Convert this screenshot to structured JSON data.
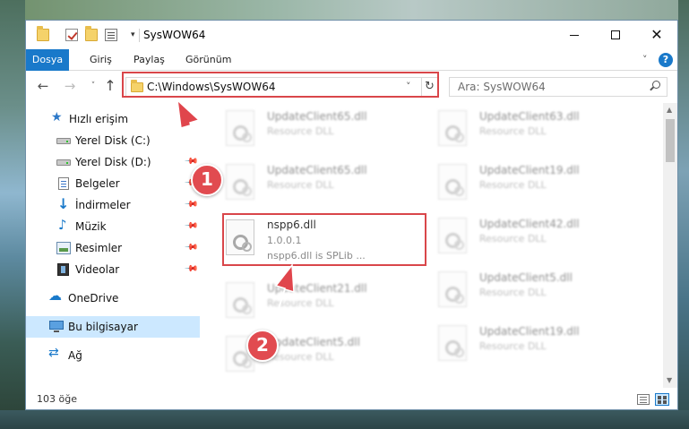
{
  "window": {
    "title": "SysWOW64",
    "minimize_icon": "minimize-icon",
    "maximize_icon": "maximize-icon",
    "close_glyph": "✕"
  },
  "ribbon": {
    "tabs": [
      {
        "label": "Dosya",
        "active": true
      },
      {
        "label": "Giriş",
        "active": false
      },
      {
        "label": "Paylaş",
        "active": false
      },
      {
        "label": "Görünüm",
        "active": false
      }
    ],
    "help_label": "?"
  },
  "nav": {
    "address": "C:\\Windows\\SysWOW64",
    "search_placeholder": "Ara: SysWOW64"
  },
  "sidebar": {
    "items": [
      {
        "label": "Hızlı erişim",
        "icon": "star-icon"
      },
      {
        "label": "Yerel Disk (C:)",
        "icon": "drive-icon"
      },
      {
        "label": "Yerel Disk (D:)",
        "icon": "drive-icon"
      },
      {
        "label": "Belgeler",
        "icon": "documents-icon"
      },
      {
        "label": "İndirmeler",
        "icon": "downloads-icon"
      },
      {
        "label": "Müzik",
        "icon": "music-icon"
      },
      {
        "label": "Resimler",
        "icon": "pictures-icon"
      },
      {
        "label": "Videolar",
        "icon": "videos-icon"
      },
      {
        "label": "OneDrive",
        "icon": "onedrive-icon"
      },
      {
        "label": "Bu bilgisayar",
        "icon": "pc-icon",
        "selected": true
      },
      {
        "label": "Ağ",
        "icon": "network-icon"
      }
    ]
  },
  "files": {
    "left": [
      {
        "name": "UpdateClient65.dll",
        "type": "Resource DLL"
      },
      {
        "name": "UpdateClient65.dll",
        "type": "Resource DLL"
      },
      {
        "name": "nspp6.dll",
        "type": "1.0.0.1",
        "desc": "nspp6.dll is SPLib ..."
      },
      {
        "name": "UpdateClient21.dll",
        "type": "Resource DLL"
      },
      {
        "name": "UpdateClient5.dll",
        "type": "Resource DLL"
      }
    ],
    "right": [
      {
        "name": "UpdateClient63.dll",
        "type": "Resource DLL"
      },
      {
        "name": "UpdateClient19.dll",
        "type": "Resource DLL"
      },
      {
        "name": "UpdateClient42.dll",
        "type": "Resource DLL"
      },
      {
        "name": "UpdateClient5.dll",
        "type": "Resource DLL"
      },
      {
        "name": "UpdateClient19.dll",
        "type": "Resource DLL"
      }
    ]
  },
  "status": {
    "count": "103 öğe"
  },
  "annotations": {
    "marker1": "1",
    "marker2": "2",
    "color": "#e14b50"
  }
}
